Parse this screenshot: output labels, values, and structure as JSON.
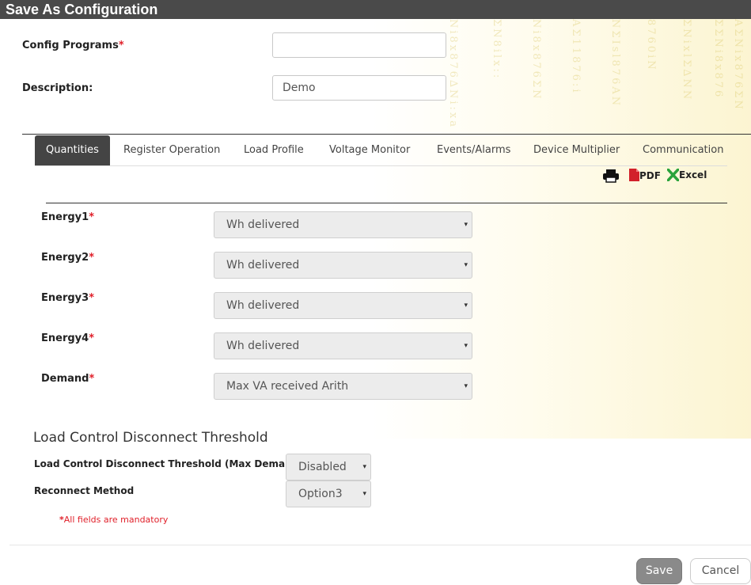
{
  "window": {
    "title": "Save As Configuration"
  },
  "form": {
    "config_programs": {
      "label": "Config Programs",
      "value": ""
    },
    "description": {
      "label": "Description:",
      "value": "Demo"
    }
  },
  "tabs": [
    {
      "label": "Quantities",
      "active": true
    },
    {
      "label": "Register Operation"
    },
    {
      "label": "Load Profile"
    },
    {
      "label": "Voltage Monitor"
    },
    {
      "label": "Events/Alarms"
    },
    {
      "label": "Device Multiplier"
    },
    {
      "label": "Communication"
    }
  ],
  "export": {
    "print_icon": "printer-icon",
    "pdf_label": "PDF",
    "excel_label": "Excel"
  },
  "quantities": [
    {
      "label": "Energy1",
      "value": "Wh delivered"
    },
    {
      "label": "Energy2",
      "value": "Wh delivered"
    },
    {
      "label": "Energy3",
      "value": "Wh delivered"
    },
    {
      "label": "Energy4",
      "value": "Wh delivered"
    },
    {
      "label": "Demand",
      "value": "Max VA received Arith"
    }
  ],
  "load_control": {
    "section_title": "Load Control Disconnect Threshold",
    "threshold": {
      "label": "Load Control Disconnect Threshold (Max Demand)",
      "value": "Disabled"
    },
    "reconnect": {
      "label": "Reconnect Method",
      "value": "Option3"
    }
  },
  "mandatory_note": "All fields are mandatory",
  "required_mark": "*",
  "caret": "▾",
  "buttons": {
    "save": "Save",
    "cancel": "Cancel"
  },
  "colors": {
    "title_bar": "#4a4a4a",
    "required": "#e0202a",
    "active_tab": "#444444"
  }
}
